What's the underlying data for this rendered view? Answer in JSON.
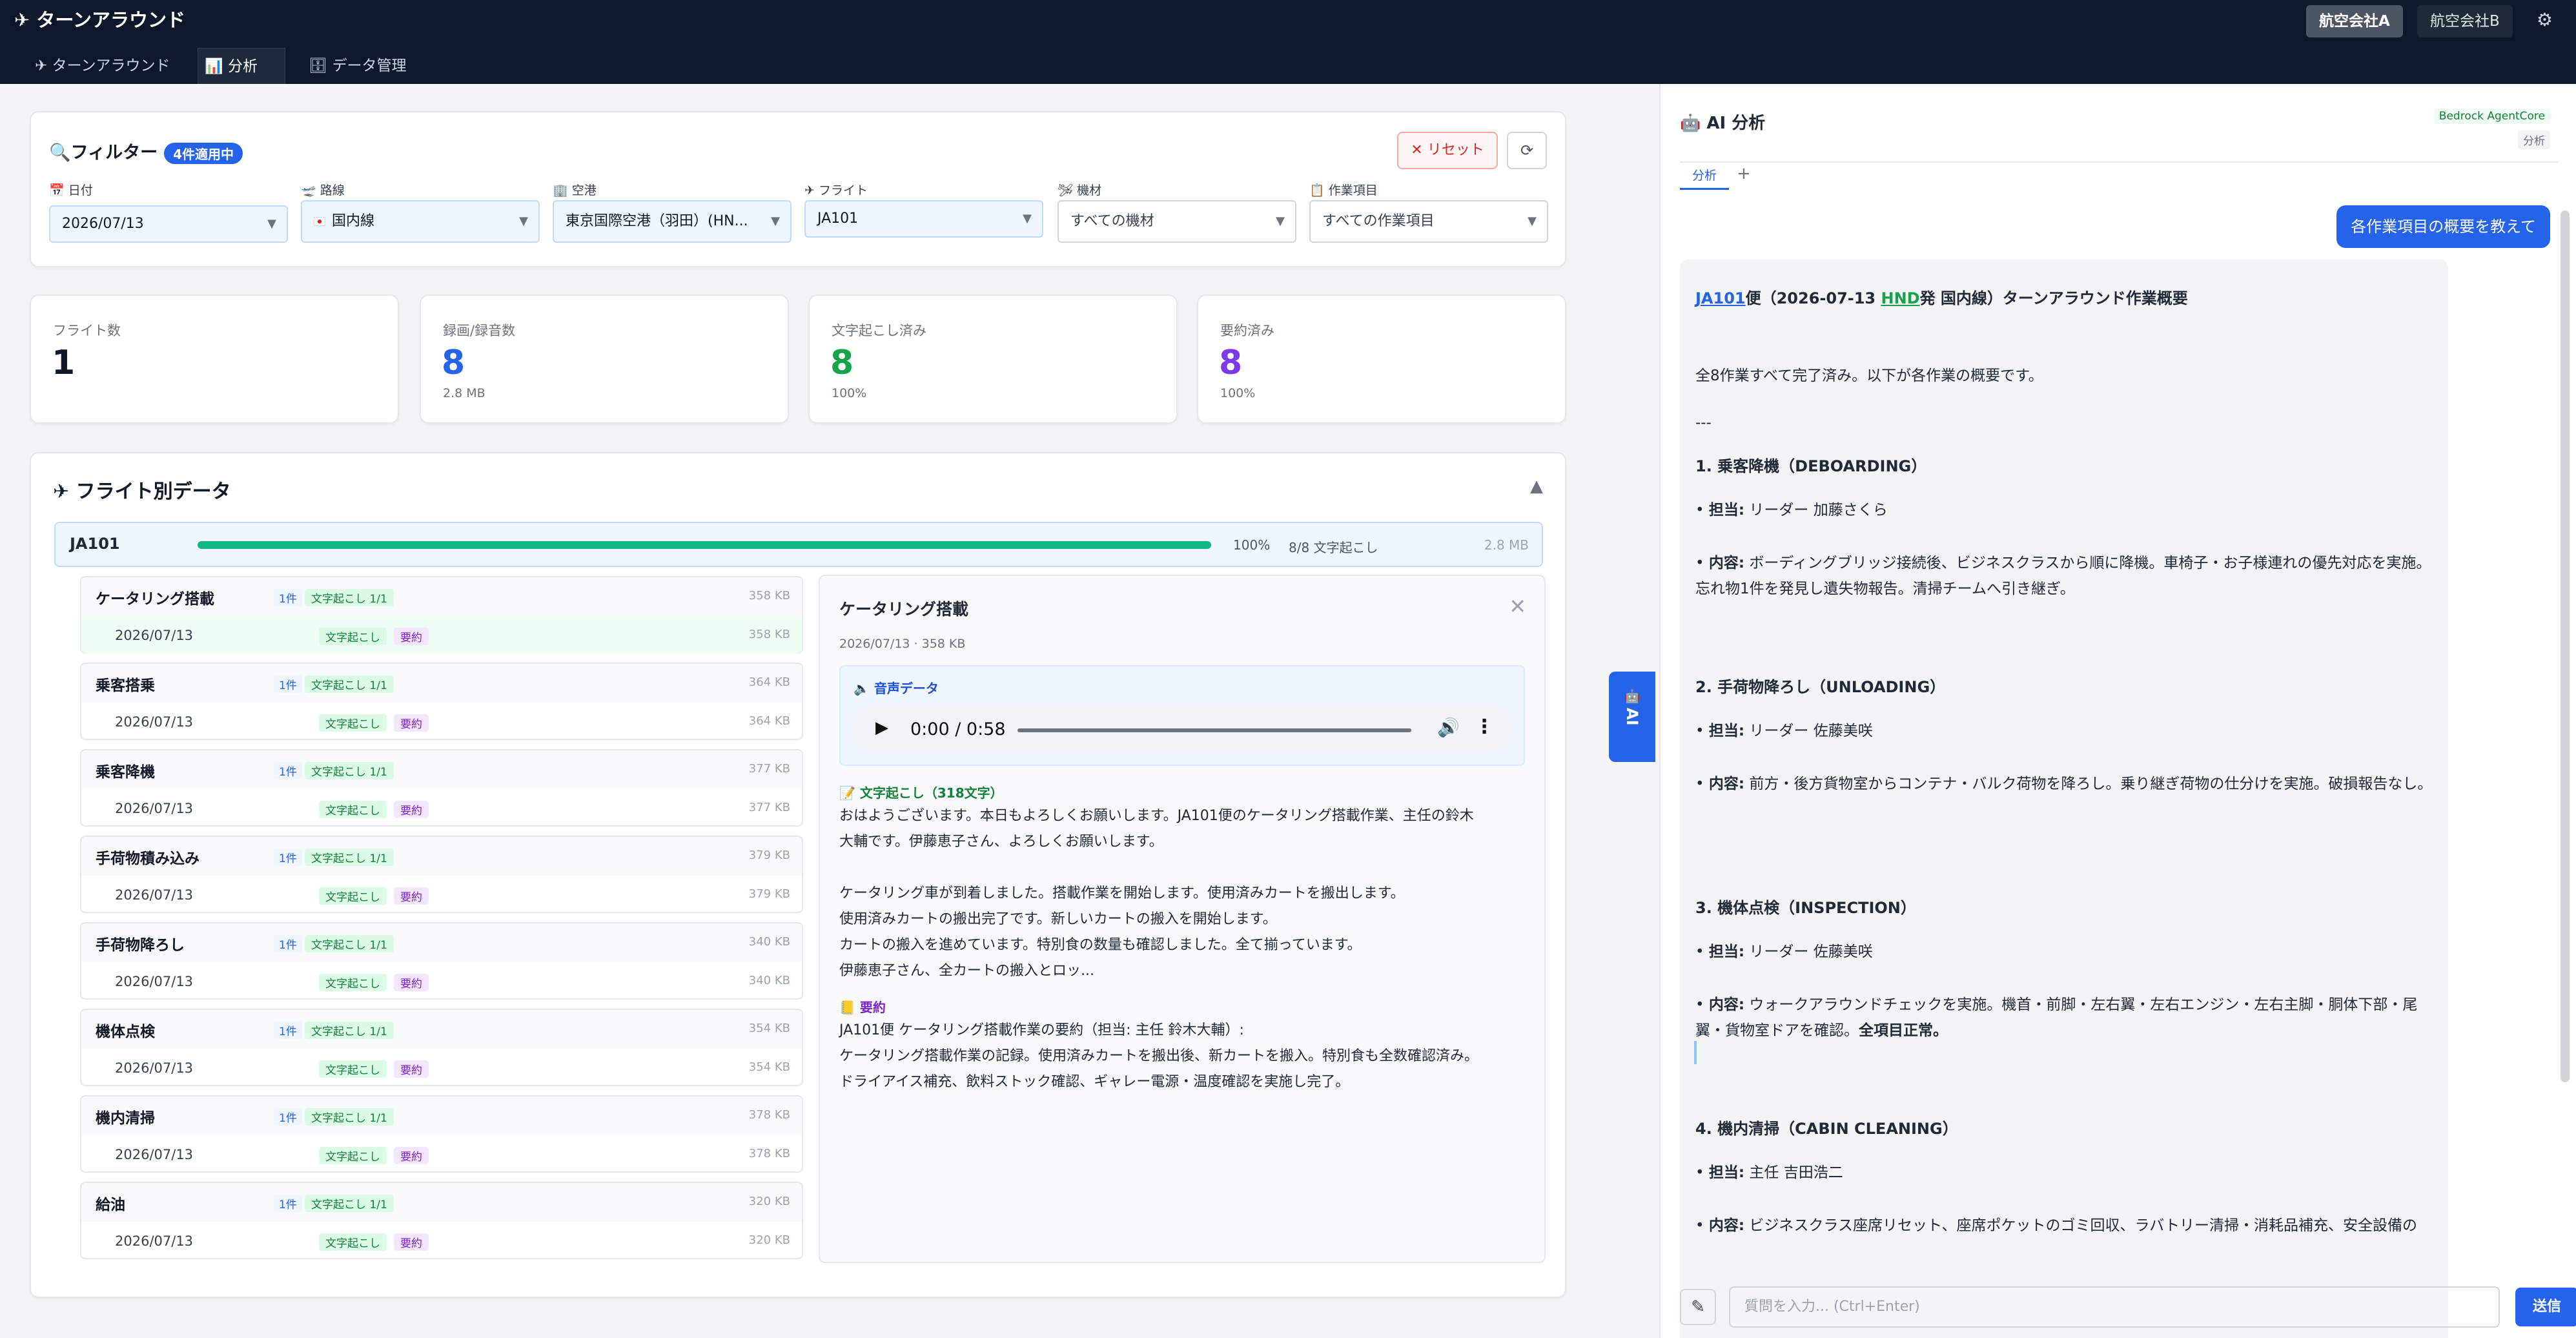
{
  "header": {
    "app_title": "✈ ターンアラウンド",
    "tabs": [
      {
        "icon": "✈",
        "label": "ターンアラウンド"
      },
      {
        "icon": "📊",
        "label": "分析"
      },
      {
        "icon": "🗄",
        "label": "データ管理"
      }
    ],
    "airlines": [
      "航空会社A",
      "航空会社B"
    ],
    "settings_icon": "⚙"
  },
  "filter": {
    "title": "フィルター",
    "active_badge": "4件適用中",
    "reset_label": "✕ リセット",
    "refresh_icon": "⟳",
    "fields": [
      {
        "label": "日付",
        "icon": "📅",
        "value": "2026/07/13"
      },
      {
        "label": "路線",
        "icon": "🛫",
        "value": "国内線"
      },
      {
        "label": "空港",
        "icon": "🏢",
        "value": "東京国際空港（羽田）(HN..."
      },
      {
        "label": "フライト",
        "icon": "✈",
        "value": "JA101"
      },
      {
        "label": "機材",
        "icon": "🛩",
        "value": "すべての機材"
      },
      {
        "label": "作業項目",
        "icon": "📋",
        "value": "すべての作業項目"
      }
    ]
  },
  "stats": [
    {
      "label": "フライト数",
      "value": "1",
      "sub": "",
      "color": "#111827"
    },
    {
      "label": "録画/録音数",
      "value": "8",
      "sub": "2.8 MB",
      "color": "#2563eb"
    },
    {
      "label": "文字起こし済み",
      "value": "8",
      "sub": "100%",
      "color": "#16a34a"
    },
    {
      "label": "要約済み",
      "value": "8",
      "sub": "100%",
      "color": "#7c3aed"
    }
  ],
  "flights_section": {
    "title": "✈ フライト別データ",
    "collapse_icon": "▲",
    "flight": {
      "name": "JA101",
      "progress": 1.0,
      "percent": "100%",
      "transcribed": "8/8 文字起こし",
      "size": "2.8 MB"
    },
    "tasks": [
      {
        "name": "ケータリング搭載",
        "count": "1件",
        "tr": "文字起こし 1/1",
        "size": "358 KB",
        "date": "2026/07/13",
        "b1": "文字起こし",
        "b2": "要約"
      },
      {
        "name": "乗客搭乗",
        "count": "1件",
        "tr": "文字起こし 1/1",
        "size": "364 KB",
        "date": "2026/07/13",
        "b1": "文字起こし",
        "b2": "要約"
      },
      {
        "name": "乗客降機",
        "count": "1件",
        "tr": "文字起こし 1/1",
        "size": "377 KB",
        "date": "2026/07/13",
        "b1": "文字起こし",
        "b2": "要約"
      },
      {
        "name": "手荷物積み込み",
        "count": "1件",
        "tr": "文字起こし 1/1",
        "size": "379 KB",
        "date": "2026/07/13",
        "b1": "文字起こし",
        "b2": "要約"
      },
      {
        "name": "手荷物降ろし",
        "count": "1件",
        "tr": "文字起こし 1/1",
        "size": "340 KB",
        "date": "2026/07/13",
        "b1": "文字起こし",
        "b2": "要約"
      },
      {
        "name": "機体点検",
        "count": "1件",
        "tr": "文字起こし 1/1",
        "size": "354 KB",
        "date": "2026/07/13",
        "b1": "文字起こし",
        "b2": "要約"
      },
      {
        "name": "機内清掃",
        "count": "1件",
        "tr": "文字起こし 1/1",
        "size": "378 KB",
        "date": "2026/07/13",
        "b1": "文字起こし",
        "b2": "要約"
      },
      {
        "name": "給油",
        "count": "1件",
        "tr": "文字起こし 1/1",
        "size": "320 KB",
        "date": "2026/07/13",
        "b1": "文字起こし",
        "b2": "要約"
      }
    ]
  },
  "detail": {
    "title": "ケータリング搭載",
    "meta": "2026/07/13 · 358 KB",
    "audio_label": "🔈 音声データ",
    "audio_time": "0:00 / 0:58",
    "transcript_label": "📝 文字起こし（318文字）",
    "transcript": "おはようございます。本日もよろしくお願いします。JA101便のケータリング搭載作業、主任の鈴木\n大輔です。伊藤恵子さん、よろしくお願いします。\n\nケータリング車が到着しました。搭載作業を開始します。使用済みカートを搬出します。\n使用済みカートの搬出完了です。新しいカートの搬入を開始します。\nカートの搬入を進めています。特別食の数量も確認しました。全て揃っています。\n伊藤恵子さん、全カートの搬入とロッ...",
    "summary_label": "📒 要約",
    "summary": "JA101便 ケータリング搭載作業の要約（担当: 主任 鈴木大輔）:\nケータリング搭載作業の記録。使用済みカートを搬出後、新カートを搬入。特別食も全数確認済み。\nドライアイス補充、飲料ストック確認、ギャレー電源・温度確認を実施し完了。"
  },
  "ai_tab": {
    "icon": "🤖",
    "label": "AI"
  },
  "ai_panel": {
    "title": "🤖 AI 分析",
    "agent_badge": "Bedrock AgentCore",
    "mode_badge": "分析",
    "tab_label": "分析",
    "add_tab": "+",
    "user_message": "各作業項目の概要を教えて",
    "response": {
      "heading_flight": "JA101",
      "heading_mid": "便（2026-07-13 ",
      "heading_airport": "HND",
      "heading_tail": "発 国内線）ターンアラウンド作業概要",
      "intro": "全8作業すべて完了済み。以下が各作業の概要です。",
      "divider": "---",
      "sections": [
        {
          "title": "1. 乗客降機（DEBOARDING）",
          "lead_label": "担当:",
          "lead": "リーダー 加藤さくら",
          "content_label": "内容:",
          "content": "ボーディングブリッジ接続後、ビジネスクラスから順に降機。車椅子・お子様連れの優先対応を実施。忘れ物1件を発見し遺失物報告。清掃チームへ引き継ぎ。",
          "emph": ""
        },
        {
          "title": "2. 手荷物降ろし（UNLOADING）",
          "lead_label": "担当:",
          "lead": "リーダー 佐藤美咲",
          "content_label": "内容:",
          "content": "前方・後方貨物室からコンテナ・バルク荷物を降ろし。乗り継ぎ荷物の仕分けを実施。破損報告なし。",
          "emph": ""
        },
        {
          "title": "3. 機体点検（INSPECTION）",
          "lead_label": "担当:",
          "lead": "リーダー 佐藤美咲",
          "content_label": "内容:",
          "content": "ウォークアラウンドチェックを実施。機首・前脚・左右翼・左右エンジン・左右主脚・胴体下部・尾翼・貨物室ドアを確認。",
          "emph": "全項目正常。"
        },
        {
          "title": "4. 機内清掃（CABIN CLEANING）",
          "lead_label": "担当:",
          "lead": "主任 吉田浩二",
          "content_label": "内容:",
          "content": "ビジネスクラス座席リセット、座席ポケットのゴミ回収、ラバトリー清掃・消耗品補充、安全設備の",
          "emph": ""
        }
      ]
    },
    "input_placeholder": "質問を入力... (Ctrl+Enter)",
    "send_label": "送信",
    "pencil_icon": "✎"
  }
}
